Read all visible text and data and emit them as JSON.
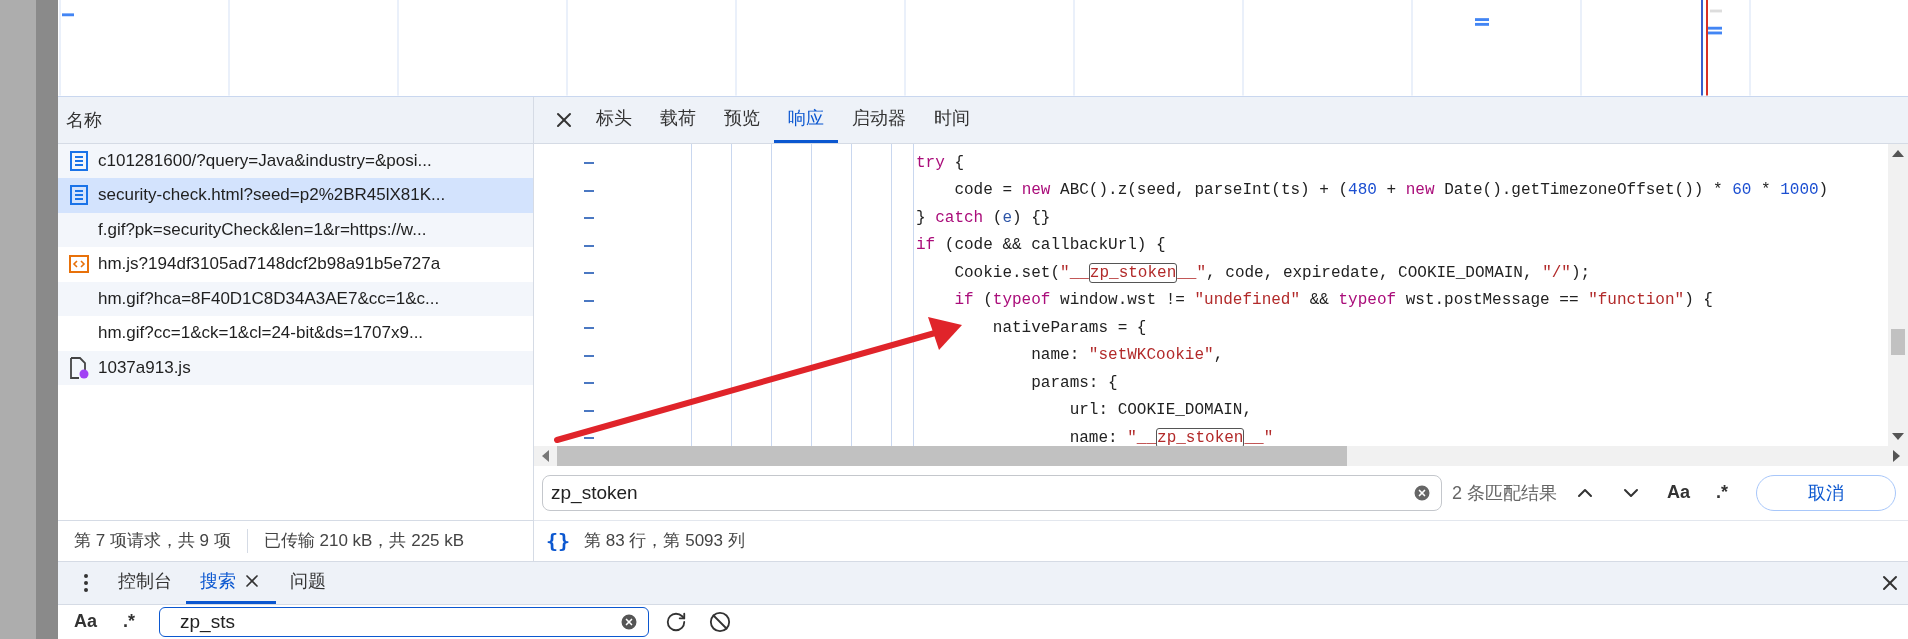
{
  "request_list": {
    "header": "名称",
    "rows": [
      {
        "name": "c101281600/?query=Java&industry=&posi...",
        "kind": "document",
        "selected": false
      },
      {
        "name": "security-check.html?seed=p2%2BR45lX81K...",
        "kind": "document",
        "selected": true
      },
      {
        "name": "f.gif?pk=securityCheck&len=1&r=https://w...",
        "kind": "plain",
        "selected": false
      },
      {
        "name": "hm.js?194df3105ad7148dcf2b98a91b5e727a",
        "kind": "script",
        "selected": false
      },
      {
        "name": "hm.gif?hca=8F40D1C8D34A3AE7&cc=1&c...",
        "kind": "plain",
        "selected": false
      },
      {
        "name": "hm.gif?cc=1&ck=1&cl=24-bit&ds=1707x9...",
        "kind": "plain",
        "selected": false
      },
      {
        "name": "1037a913.js",
        "kind": "file",
        "selected": false
      }
    ]
  },
  "status_bar": {
    "requests": "第 7 项请求，共 9 项",
    "transferred": "已传输 210 kB，共 225 kB"
  },
  "detail_tabs": [
    {
      "label": "标头",
      "selected": false
    },
    {
      "label": "载荷",
      "selected": false
    },
    {
      "label": "预览",
      "selected": false
    },
    {
      "label": "响应",
      "selected": true
    },
    {
      "label": "启动器",
      "selected": false
    },
    {
      "label": "时间",
      "selected": false
    }
  ],
  "code": {
    "lines": [
      [
        {
          "t": "try",
          "kind": "keyword"
        },
        {
          "t": " {",
          "kind": "plain"
        }
      ],
      [
        {
          "t": "    code = ",
          "kind": "plain"
        },
        {
          "t": "new",
          "kind": "keyword"
        },
        {
          "t": " ABC().z(seed, parseInt(ts) + (",
          "kind": "plain"
        },
        {
          "t": "480",
          "kind": "number"
        },
        {
          "t": " + ",
          "kind": "plain"
        },
        {
          "t": "new",
          "kind": "keyword"
        },
        {
          "t": " Date().getTimezoneOffset()) * ",
          "kind": "plain"
        },
        {
          "t": "60",
          "kind": "number"
        },
        {
          "t": " * ",
          "kind": "plain"
        },
        {
          "t": "1000",
          "kind": "number"
        },
        {
          "t": ")",
          "kind": "plain"
        }
      ],
      [
        {
          "t": "} ",
          "kind": "plain"
        },
        {
          "t": "catch",
          "kind": "keyword"
        },
        {
          "t": " (",
          "kind": "plain"
        },
        {
          "t": "e",
          "kind": "variable"
        },
        {
          "t": ") {}",
          "kind": "plain"
        }
      ],
      [
        {
          "t": "if",
          "kind": "keyword"
        },
        {
          "t": " (code && callbackUrl) {",
          "kind": "plain"
        }
      ],
      [
        {
          "t": "    Cookie.set(",
          "kind": "plain"
        },
        {
          "t": "\"__",
          "kind": "string"
        },
        {
          "t": "zp_stoken",
          "kind": "match"
        },
        {
          "t": "__\"",
          "kind": "string"
        },
        {
          "t": ", code, expiredate, COOKIE_DOMAIN, ",
          "kind": "plain"
        },
        {
          "t": "\"/\"",
          "kind": "string"
        },
        {
          "t": ");",
          "kind": "plain"
        }
      ],
      [
        {
          "t": "    if",
          "kind": "keyword"
        },
        {
          "t": " (",
          "kind": "plain"
        },
        {
          "t": "typeof",
          "kind": "keyword"
        },
        {
          "t": " window.wst != ",
          "kind": "plain"
        },
        {
          "t": "\"undefined\"",
          "kind": "string"
        },
        {
          "t": " && ",
          "kind": "plain"
        },
        {
          "t": "typeof",
          "kind": "keyword"
        },
        {
          "t": " wst.postMessage == ",
          "kind": "plain"
        },
        {
          "t": "\"function\"",
          "kind": "string"
        },
        {
          "t": ") {",
          "kind": "plain"
        }
      ],
      [
        {
          "t": "        nativeParams = {",
          "kind": "plain"
        }
      ],
      [
        {
          "t": "            name: ",
          "kind": "plain"
        },
        {
          "t": "\"setWKCookie\"",
          "kind": "string"
        },
        {
          "t": ",",
          "kind": "plain"
        }
      ],
      [
        {
          "t": "            params: {",
          "kind": "plain"
        }
      ],
      [
        {
          "t": "                url: COOKIE_DOMAIN,",
          "kind": "plain"
        }
      ],
      [
        {
          "t": "                name: ",
          "kind": "plain"
        },
        {
          "t": "\"__",
          "kind": "string"
        },
        {
          "t": "zp_stoken",
          "kind": "match"
        },
        {
          "t": "__\"",
          "kind": "string"
        }
      ]
    ]
  },
  "find_bar": {
    "value": "zp_stoken",
    "match_count": "2 条匹配结果",
    "case_label": "Aa",
    "regex_label": ".*",
    "cancel": "取消"
  },
  "cursor_position": {
    "braces": "{}",
    "text": "第 83 行，第 5093 列"
  },
  "drawer": {
    "tabs": [
      {
        "label": "控制台",
        "selected": false,
        "closable": false
      },
      {
        "label": "搜索",
        "selected": true,
        "closable": true
      },
      {
        "label": "问题",
        "selected": false,
        "closable": false
      }
    ],
    "search": {
      "case_label": "Aa",
      "regex_label": ".*",
      "value": "zp_sts"
    }
  }
}
